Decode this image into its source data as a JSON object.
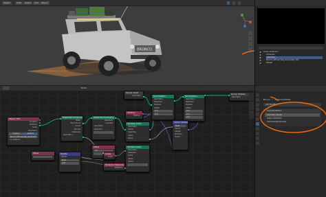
{
  "viewport": {
    "mode_label": "Object",
    "view_chips": [
      "View",
      "Select",
      "Add",
      "Object"
    ],
    "axis_x": "X",
    "axis_y": "Y",
    "axis_z": "Z"
  },
  "node_editor": {
    "header_chips": [
      "Node",
      "Add",
      "Select",
      "View"
    ],
    "nodes": {
      "object_info": {
        "title": "Object Info",
        "outputs": [
          "Location",
          "Rotation",
          "Scale",
          "Geometry"
        ],
        "toggle_a": "Original",
        "toggle_b": "Relative",
        "object_field": "Bronco_Offroad_Pkg_Generated",
        "as_instance": "As Instance"
      },
      "separate": {
        "title": "Separate Components",
        "outputs": [
          "Mesh",
          "Point Cloud",
          "Curve",
          "Volume",
          "Instances"
        ],
        "inputs": [
          "Geometry"
        ]
      },
      "separate2": {
        "title": "Separate Geometry",
        "outputs": [
          "Selection",
          "Inverted"
        ],
        "inputs": [
          "Geometry",
          "Selection"
        ]
      },
      "value_small": {
        "title": "Value",
        "value": "0.5"
      },
      "rotate": {
        "title": "Rotate",
        "rows": [
          "Vector",
          "Euler",
          "Axis"
        ]
      },
      "group_input": {
        "title": "Group Input",
        "outputs": [
          "Geometry"
        ]
      },
      "position": {
        "title": "Position",
        "outputs": [
          "Position"
        ]
      },
      "sample_index": {
        "title": "Sample Index",
        "rows": [
          "Geometry",
          "Vector",
          "Float",
          "Selection",
          "Index",
          "Value"
        ]
      },
      "set_position": {
        "title": "Set Position",
        "rows": [
          "Geometry",
          "Selection",
          "Position",
          "Offset"
        ],
        "offset_vals": [
          "0 m",
          "0 m",
          "0 m"
        ]
      },
      "set_position2": {
        "title": "Set Position",
        "rows": [
          "Geometry",
          "Selection",
          "Position",
          "Offset"
        ],
        "offset_vals": [
          "0 m",
          "0 m",
          "0 m"
        ]
      },
      "vector_rotate": {
        "title": "Vector Rotate",
        "rows": [
          "Type",
          "Euler",
          "Vector",
          "Center",
          "Rotation",
          "Invert"
        ]
      },
      "group_output": {
        "title": "Group Output",
        "inputs": [
          "Geometry"
        ]
      },
      "sample_index2": {
        "title": "Sample Index",
        "rows": [
          "Geometry",
          "Selection",
          "Index",
          "Value",
          "Vector"
        ]
      },
      "index": {
        "title": "Index",
        "outputs": [
          "Index"
        ]
      },
      "distance": {
        "title": "Distance Measure",
        "rows": [
          "Distance",
          "Geometry"
        ]
      }
    }
  },
  "outliner": {
    "rows": [
      "Scene Collection",
      "Collection",
      "Camera",
      "Light",
      "Lightsaber",
      "Bronco_Offroad_Pkg_Generated_001",
      "Wheels"
    ]
  },
  "properties": {
    "header_label": "Modifiers",
    "breadcrumb": [
      "Bronco",
      "GeometryNodes"
    ],
    "add_modifier": "Add Modifier",
    "modifier_name": "GeometryNodes",
    "rows": [
      "Geometry Nodes",
      "Output Attributes",
      "Internal Dependencies"
    ]
  },
  "colors": {
    "annotation": "#f36a12",
    "header_geometry": "#1d725e",
    "header_input": "#83314a",
    "header_vector": "#3c3c83",
    "header_group": "#3b3b3b",
    "socket_geometry": "#00d6a3",
    "socket_vector": "#6363c7",
    "socket_float": "#a1a1a1",
    "socket_int": "#598c5c"
  }
}
